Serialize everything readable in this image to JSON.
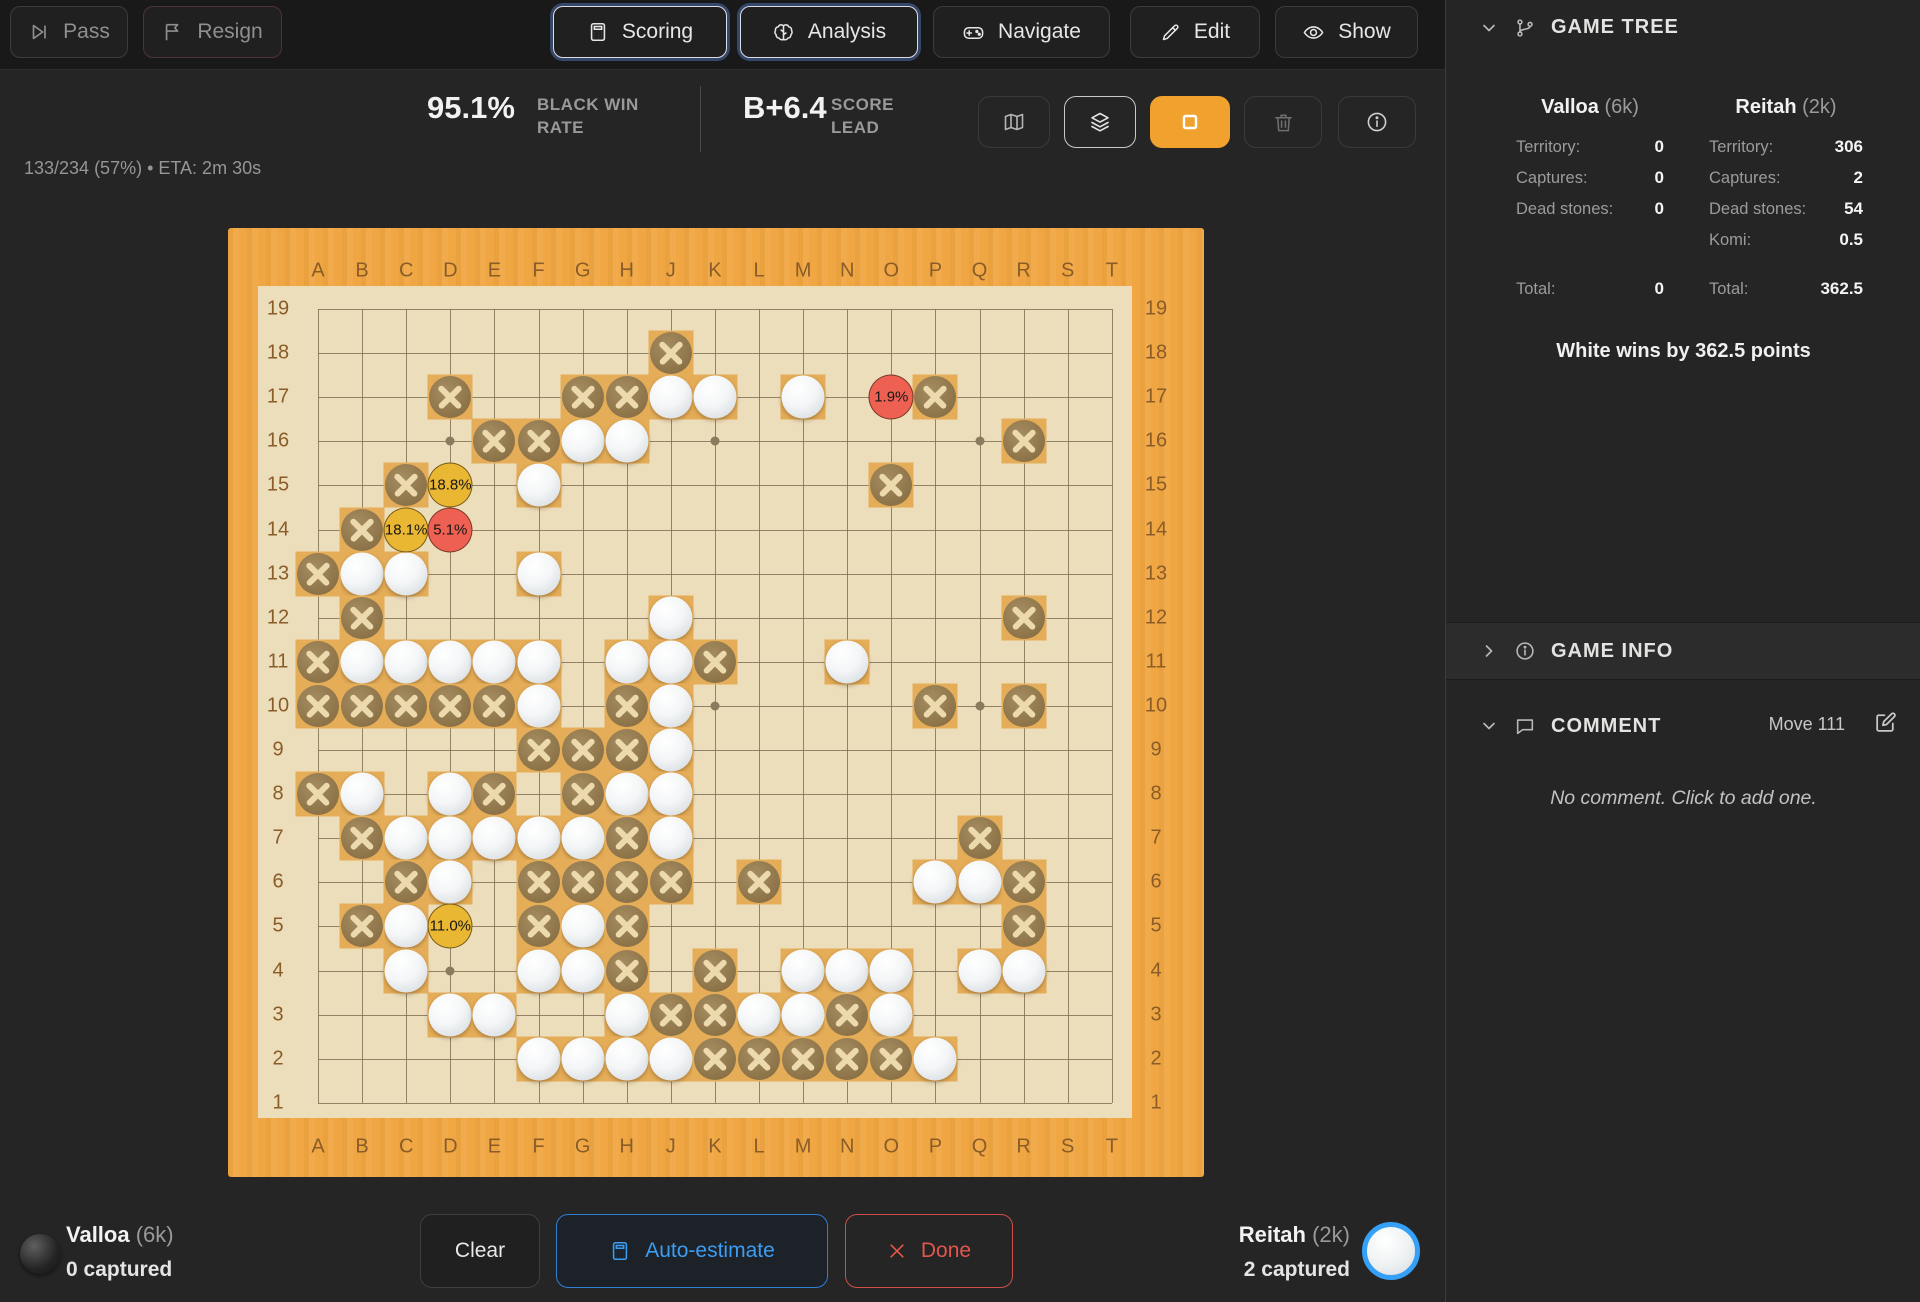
{
  "toolbar": {
    "pass": "Pass",
    "resign": "Resign",
    "scoring": "Scoring",
    "analysis": "Analysis",
    "navigate": "Navigate",
    "edit": "Edit",
    "show": "Show"
  },
  "stats": {
    "win_value": "95.1%",
    "win_label": "BLACK WIN RATE",
    "score_value": "B+6.4",
    "score_label": "SCORE LEAD",
    "progress": "133/234 (57%) • ETA: 2m 30s"
  },
  "board": {
    "columns": [
      "A",
      "B",
      "C",
      "D",
      "E",
      "F",
      "G",
      "H",
      "J",
      "K",
      "L",
      "M",
      "N",
      "O",
      "P",
      "Q",
      "R",
      "S",
      "T"
    ],
    "row_labels": [
      "19",
      "18",
      "17",
      "16",
      "15",
      "14",
      "13",
      "12",
      "11",
      "10",
      "9",
      "8",
      "7",
      "6",
      "5",
      "4",
      "3",
      "2",
      "1"
    ],
    "star_points": [
      "D16",
      "K16",
      "Q16",
      "D10",
      "K10",
      "Q10",
      "D4",
      "K4",
      "Q4"
    ],
    "white_stones": [
      "J17",
      "K17",
      "M17",
      "G16",
      "H16",
      "F15",
      "B13",
      "C13",
      "F13",
      "J12",
      "B11",
      "C11",
      "D11",
      "E11",
      "F11",
      "H11",
      "J11",
      "N11",
      "F10",
      "J10",
      "J9",
      "B8",
      "D8",
      "H8",
      "J8",
      "C7",
      "D7",
      "E7",
      "F7",
      "G7",
      "J7",
      "D6",
      "P6",
      "Q6",
      "C5",
      "G5",
      "C4",
      "F4",
      "G4",
      "M4",
      "N4",
      "O4",
      "Q4",
      "R4",
      "D3",
      "E3",
      "H3",
      "L3",
      "M3",
      "O3",
      "F2",
      "G2",
      "H2",
      "J2",
      "P2"
    ],
    "dead_stones": [
      "J18",
      "D17",
      "G17",
      "H17",
      "P17",
      "E16",
      "F16",
      "R16",
      "C15",
      "O15",
      "B14",
      "A13",
      "B12",
      "R12",
      "A11",
      "K11",
      "A10",
      "B10",
      "C10",
      "D10",
      "E10",
      "H10",
      "P10",
      "R10",
      "F9",
      "G9",
      "H9",
      "A8",
      "E8",
      "G8",
      "B7",
      "H7",
      "Q7",
      "C6",
      "F6",
      "G6",
      "H6",
      "J6",
      "L6",
      "R6",
      "B5",
      "F5",
      "H5",
      "R5",
      "H4",
      "K4",
      "J3",
      "K3",
      "N3",
      "K2",
      "L2",
      "M2",
      "N2",
      "O2"
    ],
    "suggestions": [
      {
        "pos": "O17",
        "label": "1.9%",
        "color": "red"
      },
      {
        "pos": "D15",
        "label": "18.8%",
        "color": "yellow"
      },
      {
        "pos": "C14",
        "label": "18.1%",
        "color": "yellow"
      },
      {
        "pos": "D14",
        "label": "5.1%",
        "color": "red"
      },
      {
        "pos": "D5",
        "label": "11.0%",
        "color": "yellow"
      }
    ]
  },
  "sidebar": {
    "game_tree_title": "GAME TREE",
    "labels": {
      "territory": "Territory:",
      "captures": "Captures:",
      "dead": "Dead stones:",
      "komi": "Komi:",
      "total": "Total:"
    },
    "players": {
      "black": {
        "name": "Valloa",
        "rank": "(6k)",
        "territory": "0",
        "captures": "0",
        "dead": "0",
        "total": "0"
      },
      "white": {
        "name": "Reitah",
        "rank": "(2k)",
        "territory": "306",
        "captures": "2",
        "dead": "54",
        "komi": "0.5",
        "total": "362.5"
      }
    },
    "result": "White wins by 362.5 points",
    "game_info_title": "GAME INFO",
    "comment": {
      "title": "COMMENT",
      "move": "Move 111",
      "empty": "No comment. Click to add one."
    }
  },
  "footer": {
    "black_name": "Valloa",
    "black_rank": "(6k)",
    "black_captured": "0 captured",
    "white_name": "Reitah",
    "white_rank": "(2k)",
    "white_captured": "2 captured",
    "clear": "Clear",
    "auto": "Auto-estimate",
    "done": "Done"
  },
  "colors": {
    "accent_orange": "#f1a22e",
    "accent_blue": "#3b9df2",
    "accent_red": "#e2564c",
    "board_frame": "#f0a743",
    "territory": "#ecddbb",
    "stone_square": "#e5ad58",
    "suggestion_yellow": "#eab733",
    "suggestion_red": "#ee6152"
  }
}
